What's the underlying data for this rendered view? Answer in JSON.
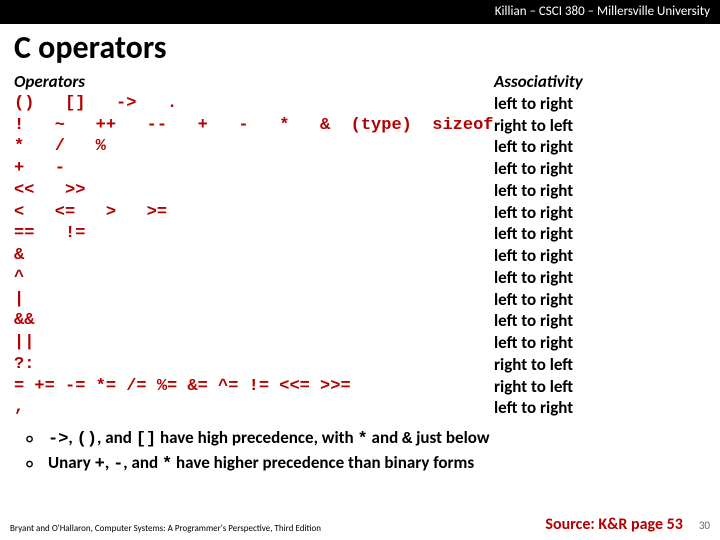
{
  "header": "Killian – CSCI 380 – Millersville University",
  "title": "C operators",
  "table": {
    "header": {
      "ops": "Operators",
      "assoc": "Associativity"
    },
    "rows": [
      {
        "ops": "()   []   ->   .",
        "assoc": "left to right"
      },
      {
        "ops": "!   ~   ++   --   +   -   *   &  (type)  sizeof",
        "assoc": "right to left"
      },
      {
        "ops": "*   /   %",
        "assoc": "left to right"
      },
      {
        "ops": "+   -",
        "assoc": "left to right"
      },
      {
        "ops": "<<   >>",
        "assoc": "left to right"
      },
      {
        "ops": "<   <=   >   >=",
        "assoc": "left to right"
      },
      {
        "ops": "==   !=",
        "assoc": "left to right"
      },
      {
        "ops": "&",
        "assoc": "left to right"
      },
      {
        "ops": "^",
        "assoc": "left to right"
      },
      {
        "ops": "|",
        "assoc": "left to right"
      },
      {
        "ops": "&&",
        "assoc": "left to right"
      },
      {
        "ops": "||",
        "assoc": "left to right"
      },
      {
        "ops": "?:",
        "assoc": "right to left"
      },
      {
        "ops": "= += -= *= /= %= &= ^= != <<= >>=",
        "assoc": "right to left"
      },
      {
        "ops": ",",
        "assoc": "left to right"
      }
    ]
  },
  "bullets": [
    {
      "pre": "->",
      "mid1": ", ",
      "c2": "()",
      "mid2": ", and ",
      "c3": "[]",
      "mid3": " have high precedence, with ",
      "c4": "*",
      "mid4": " and ",
      "c5": "&",
      "post": " just below"
    },
    {
      "pre": "",
      "mid1": "Unary ",
      "c2": "+",
      "mid2": ", ",
      "c3": "-",
      "mid3": ", and ",
      "c4": "*",
      "mid4": " have higher precedence than binary forms",
      "c5": "",
      "post": ""
    }
  ],
  "footer": {
    "left": "Bryant and O'Hallaron, Computer Systems: A Programmer's Perspective, Third Edition",
    "right": "Source: K&R page 53",
    "page": "30"
  }
}
